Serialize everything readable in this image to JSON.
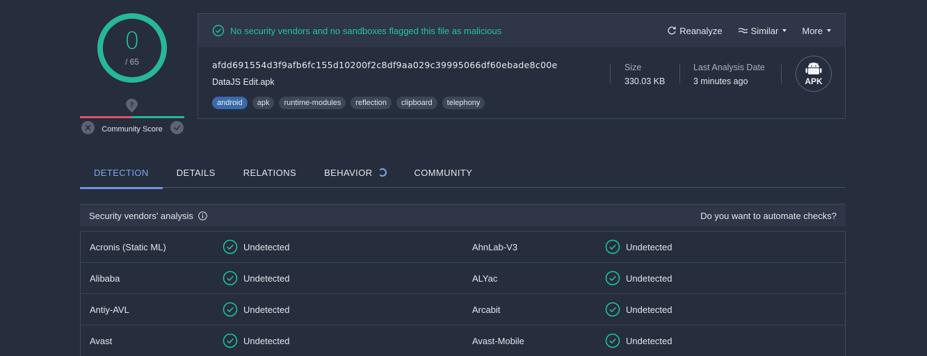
{
  "score": {
    "detections": "0",
    "total": "/ 65",
    "community_label": "Community Score"
  },
  "summary": {
    "status_text": "No security vendors and no sandboxes flagged this file as malicious",
    "actions": {
      "reanalyze": "Reanalyze",
      "similar": "Similar",
      "more": "More"
    },
    "hash": "afdd691554d3f9afb6fc155d10200f2c8df9aa029c39995066df60ebade8c00e",
    "file_name": "DataJS Edit.apk",
    "tags": [
      "android",
      "apk",
      "runtime-modules",
      "reflection",
      "clipboard",
      "telephony"
    ],
    "size_label": "Size",
    "size_value": "330.03 KB",
    "date_label": "Last Analysis Date",
    "date_value": "3 minutes ago",
    "file_type": "APK"
  },
  "tabs": [
    "DETECTION",
    "DETAILS",
    "RELATIONS",
    "BEHAVIOR",
    "COMMUNITY"
  ],
  "vendors": {
    "title": "Security vendors' analysis",
    "automate": "Do you want to automate checks?",
    "rows": [
      {
        "name1": "Acronis (Static ML)",
        "result1": "Undetected",
        "name2": "AhnLab-V3",
        "result2": "Undetected"
      },
      {
        "name1": "Alibaba",
        "result1": "Undetected",
        "name2": "ALYac",
        "result2": "Undetected"
      },
      {
        "name1": "Antiy-AVL",
        "result1": "Undetected",
        "name2": "Arcabit",
        "result2": "Undetected"
      },
      {
        "name1": "Avast",
        "result1": "Undetected",
        "name2": "Avast-Mobile",
        "result2": "Undetected"
      }
    ]
  },
  "colors": {
    "background": "#262d3c",
    "accent_green": "#23c5a3",
    "accent_blue": "#6b93e6",
    "negative_red": "#e0526a"
  }
}
